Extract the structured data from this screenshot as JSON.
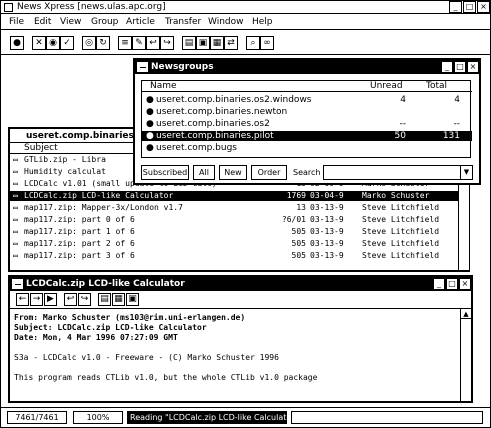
{
  "app": {
    "title": "News Xpress [news.ulas.apc.org]"
  },
  "menu": [
    "File",
    "Edit",
    "View",
    "Group",
    "Article",
    "Transfer",
    "Window",
    "Help"
  ],
  "toolbar": {
    "icons": [
      "record-icon",
      "cross-icon",
      "eye-icon",
      "mark-icon",
      "globe-icon",
      "refresh-icon",
      "list-icon",
      "post-icon",
      "reply-icon",
      "forward-icon",
      "decode-icon",
      "save-icon",
      "print-icon",
      "connect-icon",
      "find-icon",
      "binoculars-icon"
    ]
  },
  "newsgroups": {
    "title": "Newsgroups",
    "columns": {
      "name": "Name",
      "unread": "Unread",
      "total": "Total"
    },
    "rows": [
      {
        "name": "useret.comp.binaries.os2.windows",
        "unread": "4",
        "total": "4"
      },
      {
        "name": "useret.comp.binaries.newton",
        "unread": "",
        "total": ""
      },
      {
        "name": "useret.comp.binaries.os2",
        "unread": "--",
        "total": "--"
      },
      {
        "name": "useret.comp.binaries.pilot",
        "unread": "50",
        "total": "131"
      },
      {
        "name": "useret.comp.bugs",
        "unread": "",
        "total": ""
      }
    ],
    "selected_index": 3,
    "buttons": {
      "subscribed": "Subscribed",
      "all": "All",
      "new": "New",
      "order": "Order"
    },
    "search_label": "Search"
  },
  "articles": {
    "title": "useret.comp.binaries.pilot",
    "column_subject": "Subject",
    "rows": [
      {
        "subject": "GTLib.zip - Libra",
        "lines": "",
        "date": "",
        "author": ""
      },
      {
        "subject": "Humidity calculat",
        "lines": "",
        "date": "",
        "author": ""
      },
      {
        "subject": "LCDCalc v1.01 (small update to LCD-Calc)",
        "lines": "13",
        "date": "02-09-9",
        "author": "Marko Schuster"
      },
      {
        "subject": "LCDCalc.zip LCD-like Calculator",
        "lines": "1769",
        "date": "03-04-9",
        "author": "Marko Schuster"
      },
      {
        "subject": "map117.zip: Mapper-3x/London v1.7",
        "lines": "13",
        "date": "03-13-9",
        "author": "Steve Litchfield"
      },
      {
        "subject": "map117.zip: part 0 of 6",
        "lines": "?6/01",
        "date": "03-13-9",
        "author": "Steve Litchfield"
      },
      {
        "subject": "map117.zip: part 1 of 6",
        "lines": "505",
        "date": "03-13-9",
        "author": "Steve Litchfield"
      },
      {
        "subject": "map117.zip: part 2 of 6",
        "lines": "505",
        "date": "03-13-9",
        "author": "Steve Litchfield"
      },
      {
        "subject": "map117.zip: part 3 of 6",
        "lines": "505",
        "date": "03-13-9",
        "author": "Steve Litchfield"
      }
    ],
    "selected_index": 3
  },
  "article_view": {
    "title": "LCDCalc.zip LCD-like Calculator",
    "from": "From: Marko Schuster (ms103@rim.uni-erlangen.de)",
    "subject": "Subject: LCDCalc.zip LCD-like Calculator",
    "date": "Date: Mon, 4 Mar 1996 07:27:09 GMT",
    "body1": "S3a - LCDCalc v1.0 - Freeware - (C) Marko Schuster 1996",
    "body2": "This program reads CTLib v1.0, but the whole CTLib v1.0 package"
  },
  "status": {
    "count": "7461/7461",
    "progress": "100%",
    "progress_fraction": 1.0,
    "message": "Reading \"LCDCalc.zip LCD-like Calculator\"..."
  }
}
